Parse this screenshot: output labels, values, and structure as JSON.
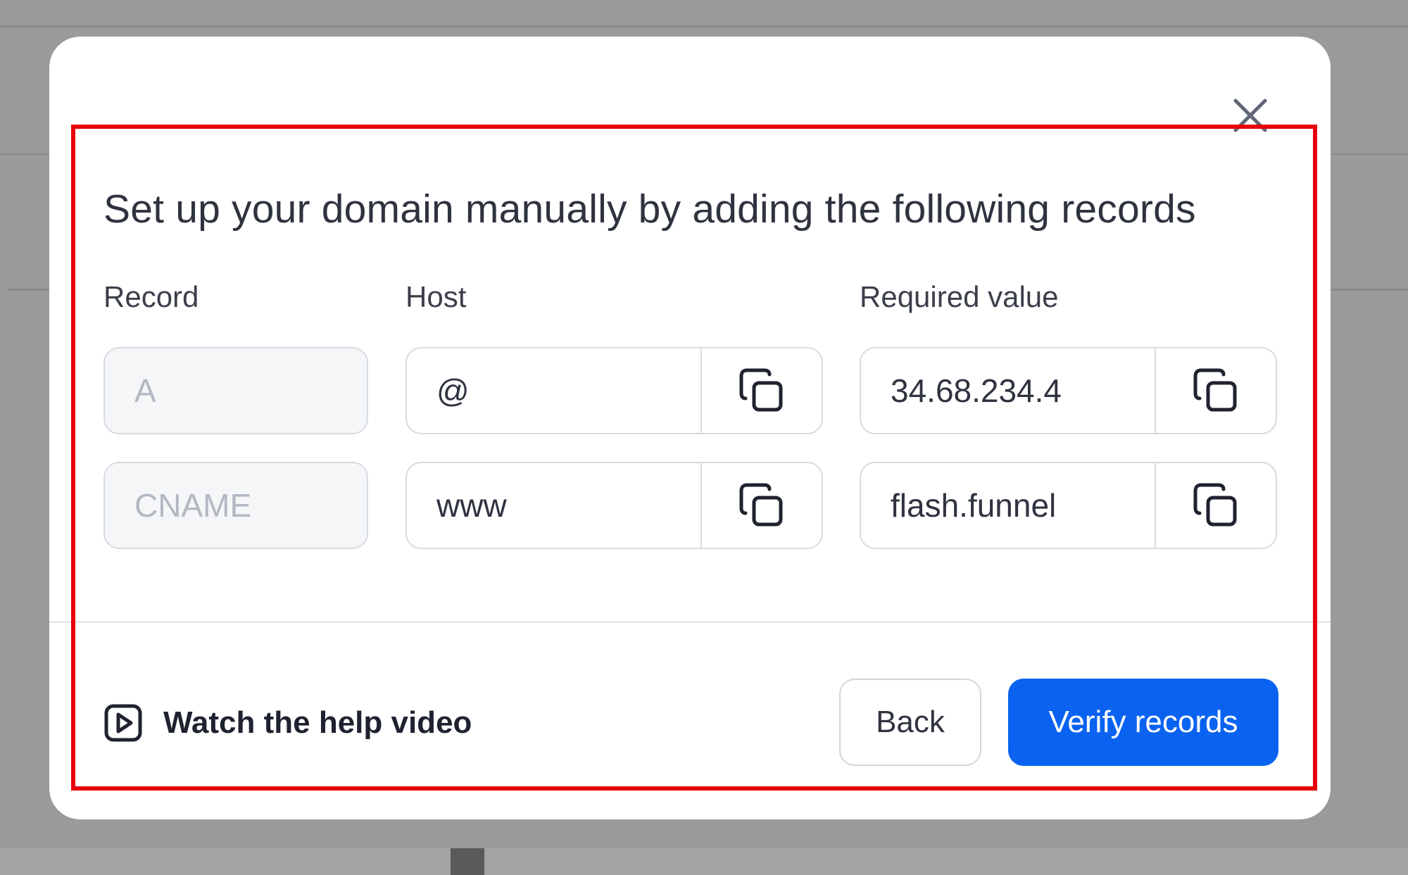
{
  "modal": {
    "title": "Set up your domain manually by adding the following records",
    "columns": {
      "record": "Record",
      "host": "Host",
      "value": "Required value"
    },
    "rows": [
      {
        "record": "A",
        "host": "@",
        "value": "34.68.234.4"
      },
      {
        "record": "CNAME",
        "host": "www",
        "value": "flash.funnel"
      }
    ],
    "help_link": "Watch the help video",
    "back_label": "Back",
    "verify_label": "Verify records"
  },
  "colors": {
    "primary": "#0a63f0",
    "highlight": "#e8000b",
    "overlay": "#9a9a9a"
  }
}
